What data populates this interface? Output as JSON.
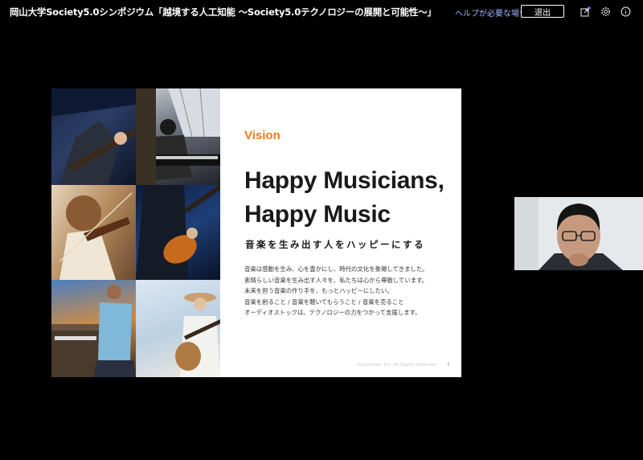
{
  "header": {
    "title": "岡山大学Society5.0シンポジウム「越境する人工知能 〜Society5.0テクノロジーの展開と可能性〜」",
    "help_link": "ヘルプが必要な場合",
    "exit_label": "退出"
  },
  "slide": {
    "kicker": "Vision",
    "headline_line1": "Happy Musicians,",
    "headline_line2": "Happy Music",
    "subhead": "音楽を生み出す人をハッピーにする",
    "body": [
      "音楽は感動を生み、心を豊かにし、時代の文化を象徴してきました。",
      "素晴らしい音楽を生み出す人々を、私たちは心から尊敬しています。",
      "未来を担う音楽の作り手を、もっとハッピーにしたい。",
      "音楽を創ること / 音楽を聴いてもらうこと / 音楽を売ること",
      "オーディオストックは、テクノロジーの力をつかって支援します。"
    ],
    "copyright": "Audiostock, Inc. All Rights Reserved.",
    "page_number": "4"
  },
  "colors": {
    "accent": "#f07a1a",
    "link": "#9db7ff",
    "background": "#000000"
  }
}
